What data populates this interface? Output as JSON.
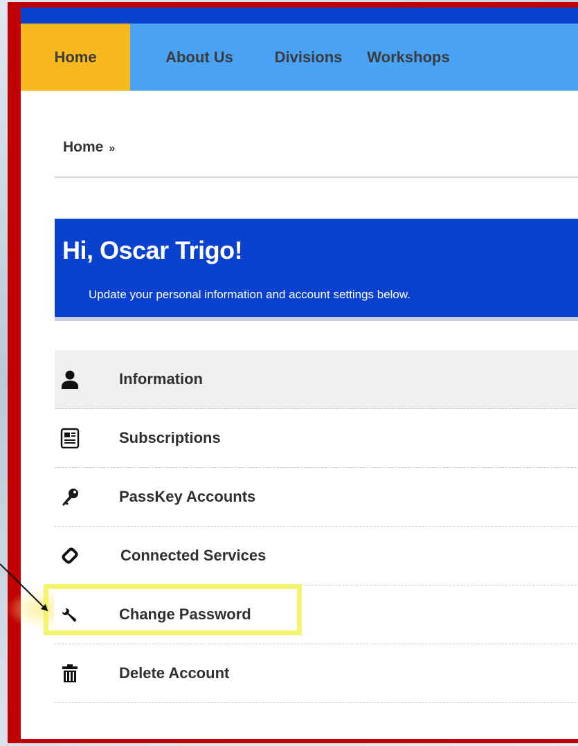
{
  "nav": {
    "items": [
      {
        "label": "Home",
        "active": true
      },
      {
        "label": "About Us"
      },
      {
        "label": "Divisions"
      },
      {
        "label": "Workshops"
      }
    ]
  },
  "breadcrumb": {
    "home": "Home",
    "separator": "»"
  },
  "hero": {
    "title": "Hi, Oscar Trigo!",
    "subtitle": "Update your personal information and account settings below."
  },
  "menu": {
    "items": [
      {
        "label": "Information",
        "icon": "user-icon"
      },
      {
        "label": "Subscriptions",
        "icon": "newspaper-icon"
      },
      {
        "label": "PassKey Accounts",
        "icon": "key-icon"
      },
      {
        "label": "Connected Services",
        "icon": "link-icon"
      },
      {
        "label": "Change Password",
        "icon": "wrench-icon"
      },
      {
        "label": "Delete Account",
        "icon": "trash-icon"
      }
    ]
  },
  "colors": {
    "frame": "#c00000",
    "nav_bg": "#4aa2f4",
    "nav_active": "#f6b81c",
    "hero_bg": "#0a41cf",
    "highlight": "#f4f46d"
  }
}
